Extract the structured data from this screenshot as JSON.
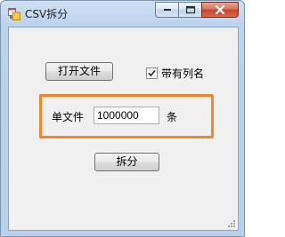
{
  "window": {
    "title": "CSV拆分",
    "icon": "app-window-icon",
    "caption_buttons": [
      "minimize",
      "maximize",
      "close"
    ]
  },
  "form": {
    "open_file_label": "打开文件",
    "has_header_label": "带有列名",
    "has_header_checked": true,
    "per_file_label": "单文件",
    "per_file_value": "1000000",
    "unit_label": "条",
    "split_label": "拆分"
  },
  "colors": {
    "highlight_border": "#f0862d",
    "form_background": "#f0f0f0"
  }
}
